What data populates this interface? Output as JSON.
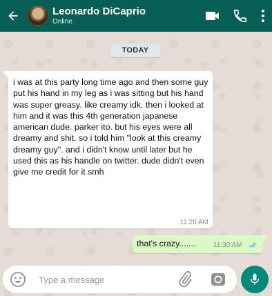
{
  "header": {
    "contact_name": "Leonardo DiCaprio",
    "status": "Online",
    "back_icon": "arrow-left-icon",
    "video_icon": "video-camera-icon",
    "call_icon": "phone-icon",
    "menu_icon": "more-vertical-icon",
    "background_color": "#075e54"
  },
  "chat": {
    "date_divider": "TODAY",
    "messages": [
      {
        "direction": "incoming",
        "text": "i was at this party long time ago and then some guy put his hand in my leg as i was sitting but his hand was super greasy. like creamy idk. then i looked at him and it was this 4th generation japanese american dude. parker ito. but his eyes were all dreamy and shit. so i told him \"look at this creamy dreamy guy\". and i didn't know until later but he used this as his handle on twitter. dude didn't even give me credit for it smh",
        "time": "11:20 AM"
      },
      {
        "direction": "outgoing",
        "text": "that's crazy.......",
        "time": "11:30 AM",
        "status_icon": "double-check-read-icon"
      }
    ]
  },
  "composer": {
    "placeholder": "Type a message",
    "emoji_icon": "emoji-icon",
    "attach_icon": "paperclip-icon",
    "camera_icon": "camera-icon",
    "mic_icon": "microphone-icon",
    "send_button_color": "#00897b"
  }
}
